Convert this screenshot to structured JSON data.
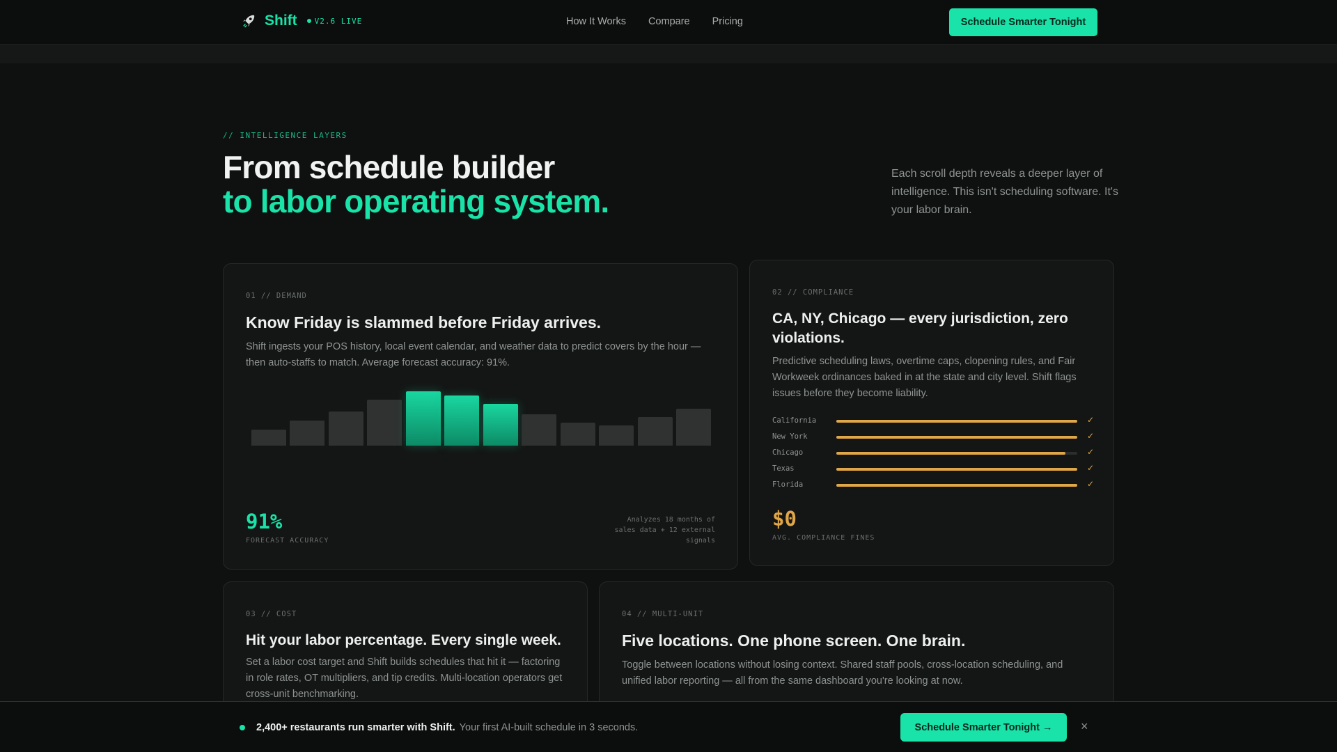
{
  "nav": {
    "brand": "Shift",
    "version": "V2.6 LIVE",
    "links": [
      "How It Works",
      "Compare",
      "Pricing"
    ],
    "cta": "Schedule Smarter Tonight"
  },
  "hero": {
    "eyebrow": "// INTELLIGENCE LAYERS",
    "title_line1": "From schedule builder",
    "title_line2": "to labor operating system.",
    "description": "Each scroll depth reveals a deeper layer of intelligence. This isn't scheduling software. It's your labor brain."
  },
  "cards": {
    "demand": {
      "tag": "01 // DEMAND",
      "title": "Know Friday is slammed before Friday arrives.",
      "description": "Shift ingests your POS history, local event calendar, and weather data to predict covers by the hour — then auto-staffs to match. Average forecast accuracy: 91%.",
      "stat": "91%",
      "stat_label": "FORECAST ACCURACY",
      "note": "Analyzes 18 months of sales data + 12 external signals"
    },
    "compliance": {
      "tag": "02 // COMPLIANCE",
      "title": "CA, NY, Chicago — every jurisdiction, zero violations.",
      "description": "Predictive scheduling laws, overtime caps, clopening rules, and Fair Workweek ordinances baked in at the state and city level. Shift flags issues before they become liability.",
      "jurisdictions": [
        {
          "name": "California",
          "level": 1.0
        },
        {
          "name": "New York",
          "level": 1.0
        },
        {
          "name": "Chicago",
          "level": 0.95
        },
        {
          "name": "Texas",
          "level": 1.0
        },
        {
          "name": "Florida",
          "level": 1.0
        }
      ],
      "check": "✓",
      "stat": "$0",
      "stat_label": "AVG. COMPLIANCE FINES"
    },
    "cost": {
      "tag": "03 // COST",
      "title": "Hit your labor percentage. Every single week.",
      "description": "Set a labor cost target and Shift builds schedules that hit it — factoring in role rates, OT multipliers, and tip credits. Multi-location operators get cross-unit benchmarking."
    },
    "multi": {
      "tag": "04 // MULTI-UNIT",
      "title": "Five locations. One phone screen. One brain.",
      "description": "Toggle between locations without losing context. Shared staff pools, cross-location scheduling, and unified labor reporting — all from the same dashboard you're looking at now."
    }
  },
  "chart_data": {
    "type": "bar",
    "values": [
      23,
      36,
      49,
      66,
      78,
      72,
      60,
      45,
      33,
      29,
      41,
      53
    ],
    "highlighted": [
      4,
      5,
      6
    ],
    "ylim": [
      0,
      80
    ]
  },
  "bottom_bar": {
    "headline": "2,400+ restaurants run smarter with Shift.",
    "subtext": "Your first AI-built schedule in 3 seconds.",
    "cta": "Schedule Smarter Tonight →",
    "close": "×"
  },
  "colors": {
    "accent": "#19e3a8",
    "amber": "#e0a648",
    "background": "#0f1110"
  }
}
